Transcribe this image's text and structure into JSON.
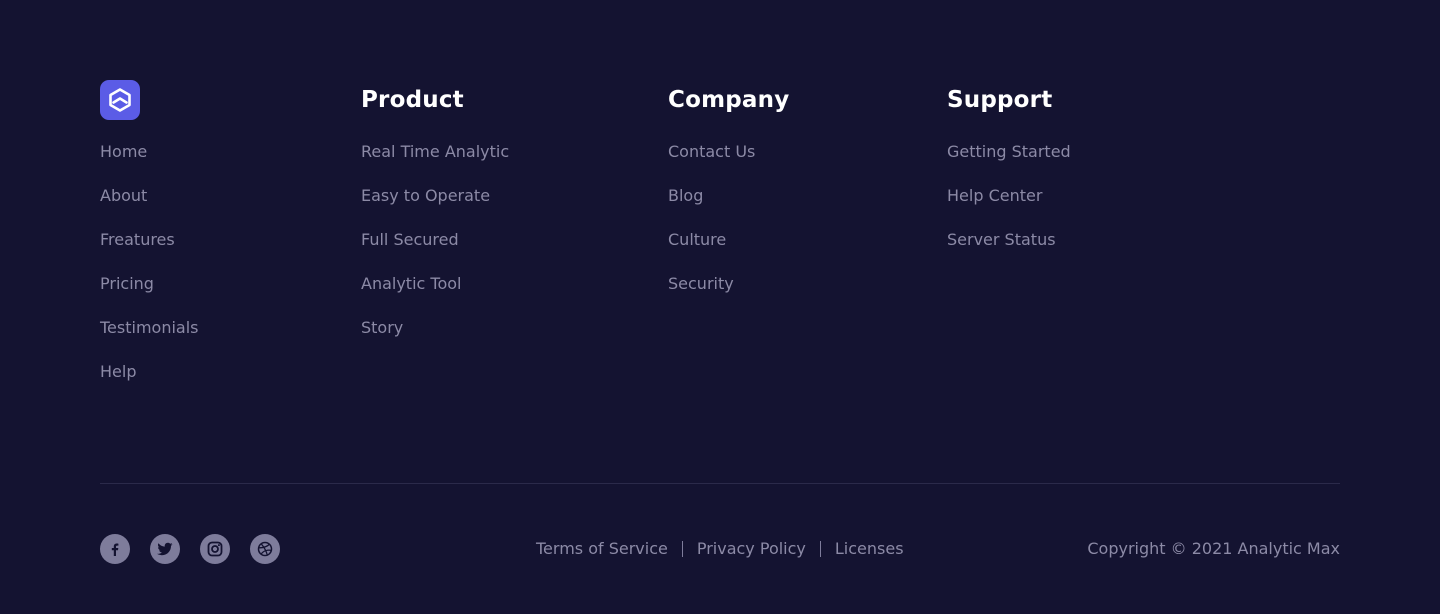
{
  "brand": {
    "logo_icon": "hexagon-logo-icon",
    "accent_color": "#5b5ce6",
    "links": [
      "Home",
      "About",
      "Freatures",
      "Pricing",
      "Testimonials",
      "Help"
    ]
  },
  "product": {
    "heading": "Product",
    "links": [
      "Real Time Analytic",
      "Easy to Operate",
      "Full Secured",
      "Analytic Tool",
      "Story"
    ]
  },
  "company": {
    "heading": "Company",
    "links": [
      "Contact Us",
      "Blog",
      "Culture",
      "Security"
    ]
  },
  "support": {
    "heading": "Support",
    "links": [
      "Getting Started",
      "Help Center",
      "Server Status"
    ]
  },
  "social": {
    "icons": [
      "facebook-icon",
      "twitter-icon",
      "instagram-icon",
      "dribbble-icon"
    ]
  },
  "legal": {
    "terms": "Terms of Service",
    "privacy": "Privacy Policy",
    "licenses": "Licenses"
  },
  "copyright": "Copyright ©  2021 Analytic Max",
  "colors": {
    "background": "#141331",
    "heading": "#ffffff",
    "link": "#8c8aa6",
    "divider": "#2b2a4a"
  }
}
